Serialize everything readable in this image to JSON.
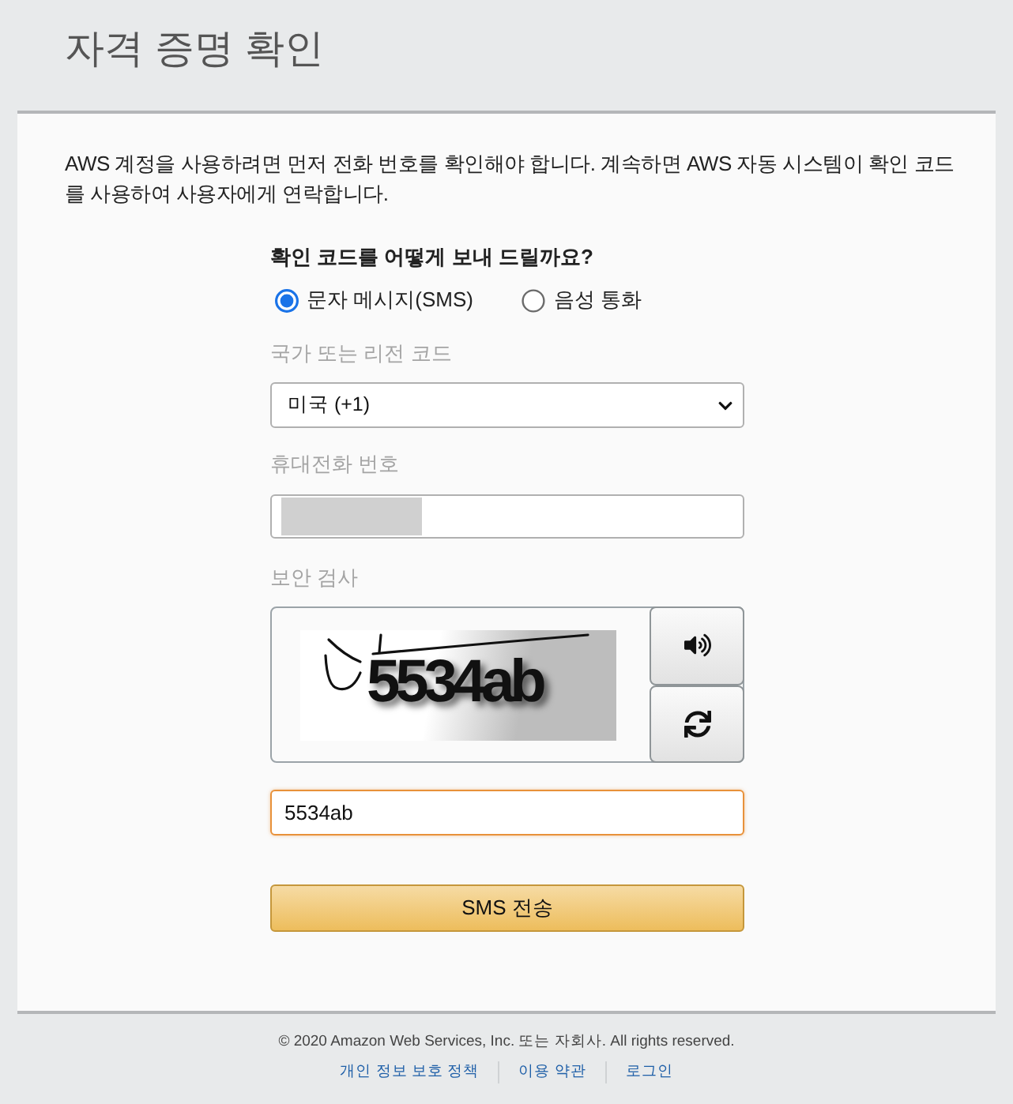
{
  "page": {
    "title": "자격 증명 확인"
  },
  "card": {
    "intro": "AWS 계정을 사용하려면 먼저 전화 번호를 확인해야 합니다. 계속하면 AWS 자동 시스템이 확인 코드를 사용하여 사용자에게 연락합니다."
  },
  "form": {
    "question": "확인 코드를 어떻게 보내 드릴까요?",
    "methods": [
      {
        "label": "문자 메시지(SMS)",
        "selected": true
      },
      {
        "label": "음성 통화",
        "selected": false
      }
    ],
    "country": {
      "label": "국가 또는 리전 코드",
      "value": "미국 (+1)"
    },
    "phone": {
      "label": "휴대전화 번호",
      "redacted": true
    },
    "captcha": {
      "label": "보안 검사",
      "image_text": "5534ab",
      "answer": {
        "value": "5534ab",
        "focused": true
      }
    },
    "submit": "SMS 전송"
  },
  "footer": {
    "copyright": "© 2020 Amazon Web Services, Inc. 또는 자회사. All rights reserved.",
    "links": [
      "개인 정보 보호 정책",
      "이용 약관",
      "로그인"
    ]
  }
}
